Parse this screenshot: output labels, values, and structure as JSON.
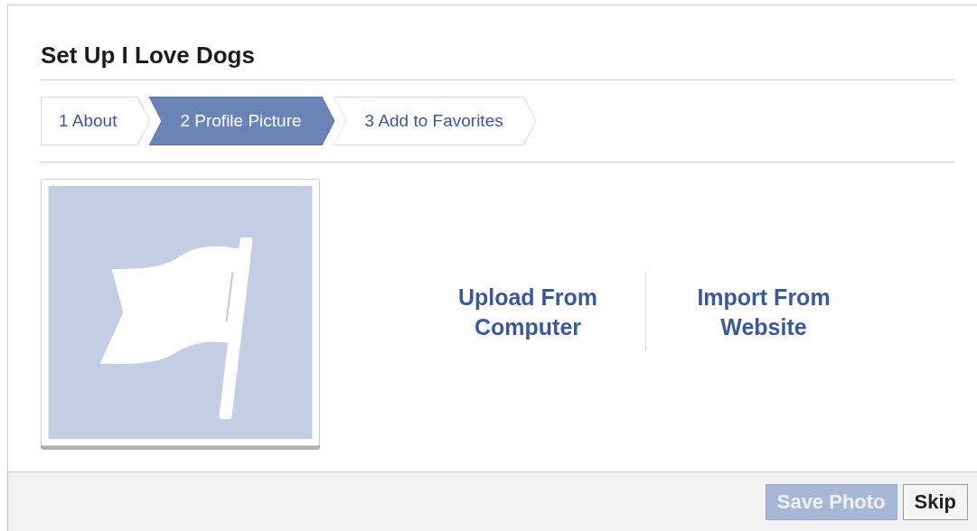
{
  "dialog": {
    "title": "Set Up I Love Dogs"
  },
  "steps": [
    {
      "label": "1 About",
      "selected": false
    },
    {
      "label": "2 Profile Picture",
      "selected": true
    },
    {
      "label": "3 Add to Favorites",
      "selected": false
    }
  ],
  "photo": {
    "kind": "flag-placeholder"
  },
  "options": [
    {
      "label": "Upload From Computer"
    },
    {
      "label": "Import From Website"
    }
  ],
  "buttons": [
    {
      "label": "Save Photo",
      "disabled": true
    },
    {
      "label": "Skip",
      "disabled": false
    }
  ]
}
